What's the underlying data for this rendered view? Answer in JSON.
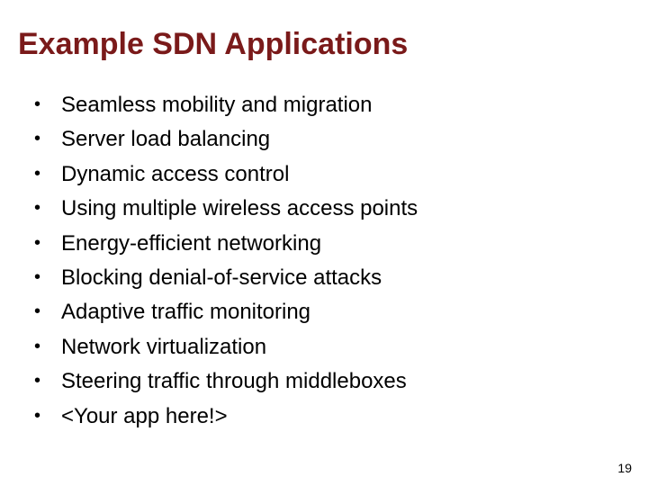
{
  "slide": {
    "title": "Example SDN Applications",
    "bullets": [
      "Seamless mobility and migration",
      "Server load balancing",
      "Dynamic access control",
      "Using multiple wireless access points",
      "Energy-efficient networking",
      "Blocking denial-of-service attacks",
      "Adaptive traffic monitoring",
      "Network virtualization",
      "Steering traffic through middleboxes",
      "<Your app here!>"
    ],
    "page_number": "19"
  }
}
